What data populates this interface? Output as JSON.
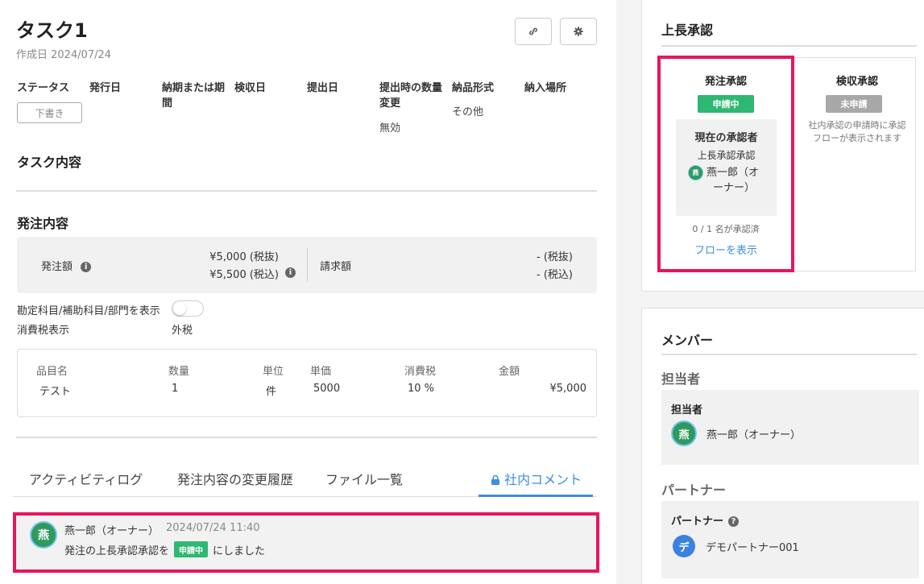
{
  "task": {
    "title": "タスク1",
    "created": "作成日 2024/07/24"
  },
  "toolbar": {
    "link_icon": "link-icon",
    "settings_icon": "gear-icon"
  },
  "meta": {
    "status_label": "ステータス",
    "status_value": "下書き",
    "issue_date_label": "発行日",
    "deadline_label_1": "納期または期",
    "deadline_label_2": "間",
    "inspection_label": "検収日",
    "submit_label": "提出日",
    "qty_change_label_1": "提出時の数量",
    "qty_change_label_2": "変更",
    "qty_change_value": "無効",
    "delivery_format_label": "納品形式",
    "delivery_format_value": "その他",
    "delivery_place_label": "納入場所"
  },
  "sections": {
    "task_content": "タスク内容",
    "order_content": "発注内容"
  },
  "amounts": {
    "order_label": "発注額",
    "order_ex": "¥5,000 (税抜)",
    "order_inc": "¥5,500 (税込)",
    "invoice_label": "請求額",
    "invoice_ex": "- (税抜)",
    "invoice_inc": "- (税込)"
  },
  "options": {
    "show_accounts_label": "勘定科目/補助科目/部門を表示",
    "tax_display_label": "消費税表示",
    "tax_display_value": "外税"
  },
  "items_table": {
    "headers": [
      "品目名",
      "数量",
      "単位",
      "単価",
      "消費税",
      "金額"
    ],
    "rows": [
      [
        "テスト",
        "1",
        "件",
        "5000",
        "10 %",
        "¥5,000"
      ]
    ]
  },
  "tabs": {
    "activity": "アクティビティログ",
    "history": "発注内容の変更履歴",
    "files": "ファイル一覧",
    "comments": "社内コメント"
  },
  "comment": {
    "avatar": "燕",
    "name": "燕一郎（オーナー）",
    "time": "2024/07/24 11:40",
    "text_before": "発注の上長承認承認を",
    "badge": "申請中",
    "text_after": "にしました"
  },
  "approval": {
    "title": "上長承認",
    "order": {
      "title": "発注承認",
      "badge": "申請中",
      "current_label": "現在の承認者",
      "step": "上長承認承認",
      "approver_avatar": "燕",
      "approver_line1": "燕一郎（オ",
      "approver_line2": "ーナー）",
      "count": "0 / 1 名が承認済",
      "flow_link": "フローを表示"
    },
    "inspection": {
      "title": "検収承認",
      "badge": "未申請",
      "note_line1": "社内承認の申請時に承認",
      "note_line2": "フローが表示されます"
    }
  },
  "members": {
    "title": "メンバー",
    "assignee_heading": "担当者",
    "assignee_box_title": "担当者",
    "assignee_avatar": "燕",
    "assignee_name": "燕一郎（オーナー）",
    "partner_heading": "パートナー",
    "partner_box_title": "パートナー",
    "partner_avatar": "デ",
    "partner_name": "デモパートナー001"
  },
  "colors": {
    "accent": "#3a8ee6",
    "highlight": "#e8145f",
    "badge_green": "#2eb872",
    "badge_gray": "#a8a8a8",
    "avatar_green": "#2e9a5e",
    "partner_blue": "#3b82e0"
  }
}
